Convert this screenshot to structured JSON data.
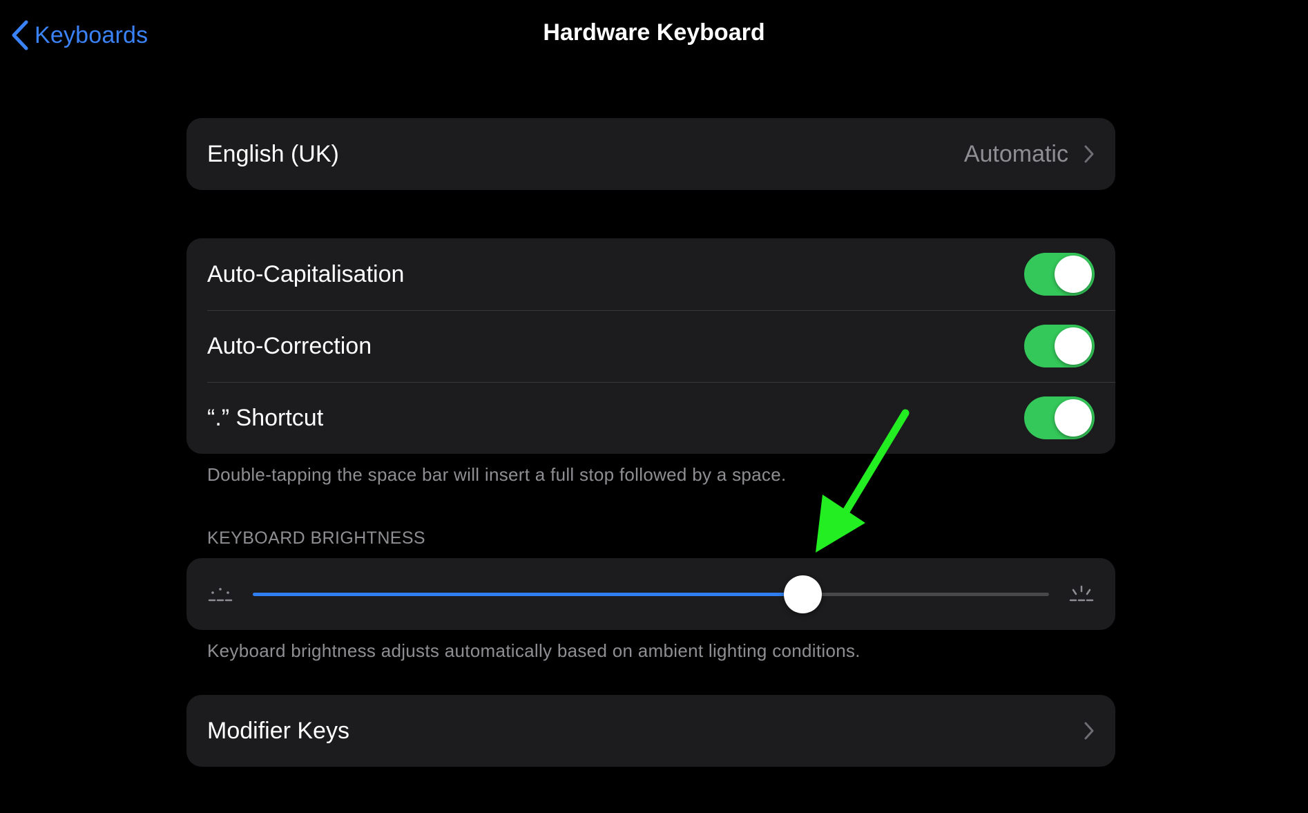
{
  "colors": {
    "accent": "#3a82f7",
    "switch_on": "#34c759",
    "slider_fill": "#2f7ff0",
    "annotation_arrow": "#22ee22"
  },
  "nav": {
    "back_label": "Keyboards",
    "back_icon": "chevron-left-icon",
    "title": "Hardware Keyboard"
  },
  "language_group": {
    "rows": [
      {
        "label": "English (UK)",
        "value": "Automatic",
        "icon": "chevron-right-icon"
      }
    ]
  },
  "typing_group": {
    "rows": [
      {
        "label": "Auto-Capitalisation",
        "enabled": true
      },
      {
        "label": "Auto-Correction",
        "enabled": true
      },
      {
        "label": "“.” Shortcut",
        "enabled": true
      }
    ],
    "footer": "Double-tapping the space bar will insert a full stop followed by a space."
  },
  "brightness": {
    "header": "KEYBOARD BRIGHTNESS",
    "level": 0.69,
    "min_icon": "brightness-low-icon",
    "max_icon": "brightness-high-icon",
    "footer": "Keyboard brightness adjusts automatically based on ambient lighting conditions."
  },
  "modifier_group": {
    "rows": [
      {
        "label": "Modifier Keys",
        "icon": "chevron-right-icon"
      }
    ]
  },
  "annotation": {
    "icon": "green-arrow-icon"
  }
}
